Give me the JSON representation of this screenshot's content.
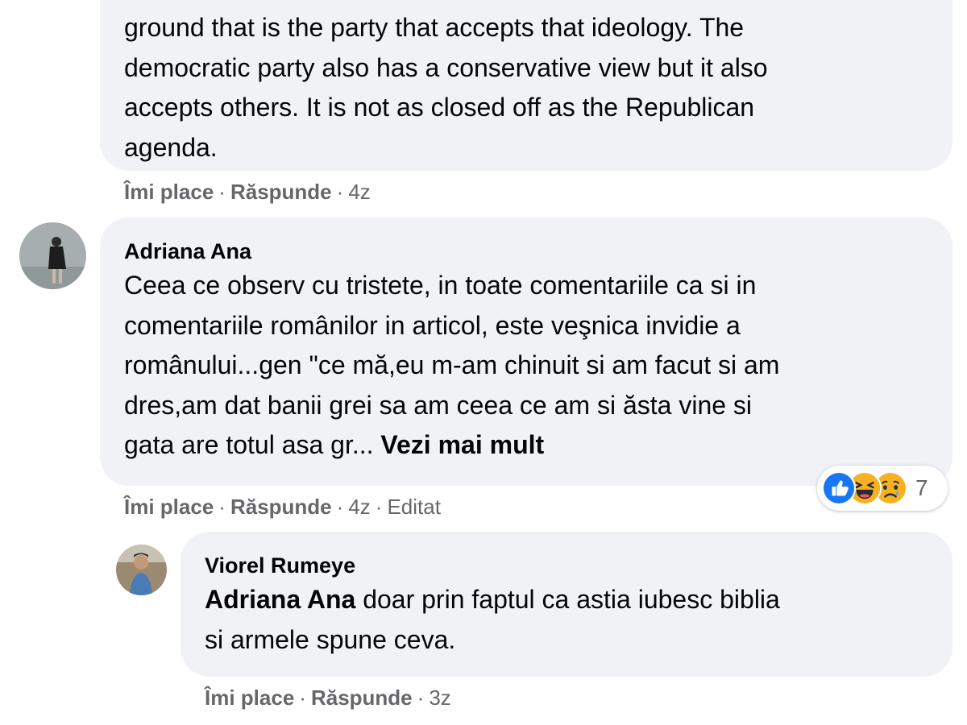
{
  "comments": [
    {
      "text_lines": [
        "ground that is the party that accepts that ideology. The",
        "democratic party also has a conservative view but it also",
        "accepts others. It is not as closed off as the Republican",
        "agenda."
      ],
      "actions": {
        "like": "Îmi place",
        "reply": "Răspunde",
        "time": "4z"
      }
    },
    {
      "author": "Adriana Ana",
      "text_lines": [
        "Ceea ce observ cu tristete, in toate comentariile ca si in",
        "comentariile românilor in articol, este veşnica invidie a",
        "românului...gen \"ce mă,eu m-am chinuit si am facut si am",
        "dres,am dat banii grei sa am ceea ce am si ăsta vine si",
        "gata are totul asa gr... "
      ],
      "see_more": "Vezi mai mult",
      "actions": {
        "like": "Îmi place",
        "reply": "Răspunde",
        "time": "4z",
        "edited": "Editat"
      },
      "reactions": {
        "icons": [
          "like-icon",
          "haha-icon",
          "sad-icon"
        ],
        "count": "7"
      }
    },
    {
      "author": "Viorel Rumeye",
      "mention": "Adriana Ana",
      "text_lines": [
        " doar prin faptul ca astia iubesc biblia",
        "si armele spune ceva."
      ],
      "actions": {
        "like": "Îmi place",
        "reply": "Răspunde",
        "time": "3z"
      }
    }
  ],
  "separator": " · ",
  "colors": {
    "bubble": "#f0f2f5",
    "meta": "#65676b",
    "text": "#050505",
    "like_blue": "#1877f2",
    "emoji_yellow": "#f7b125"
  }
}
